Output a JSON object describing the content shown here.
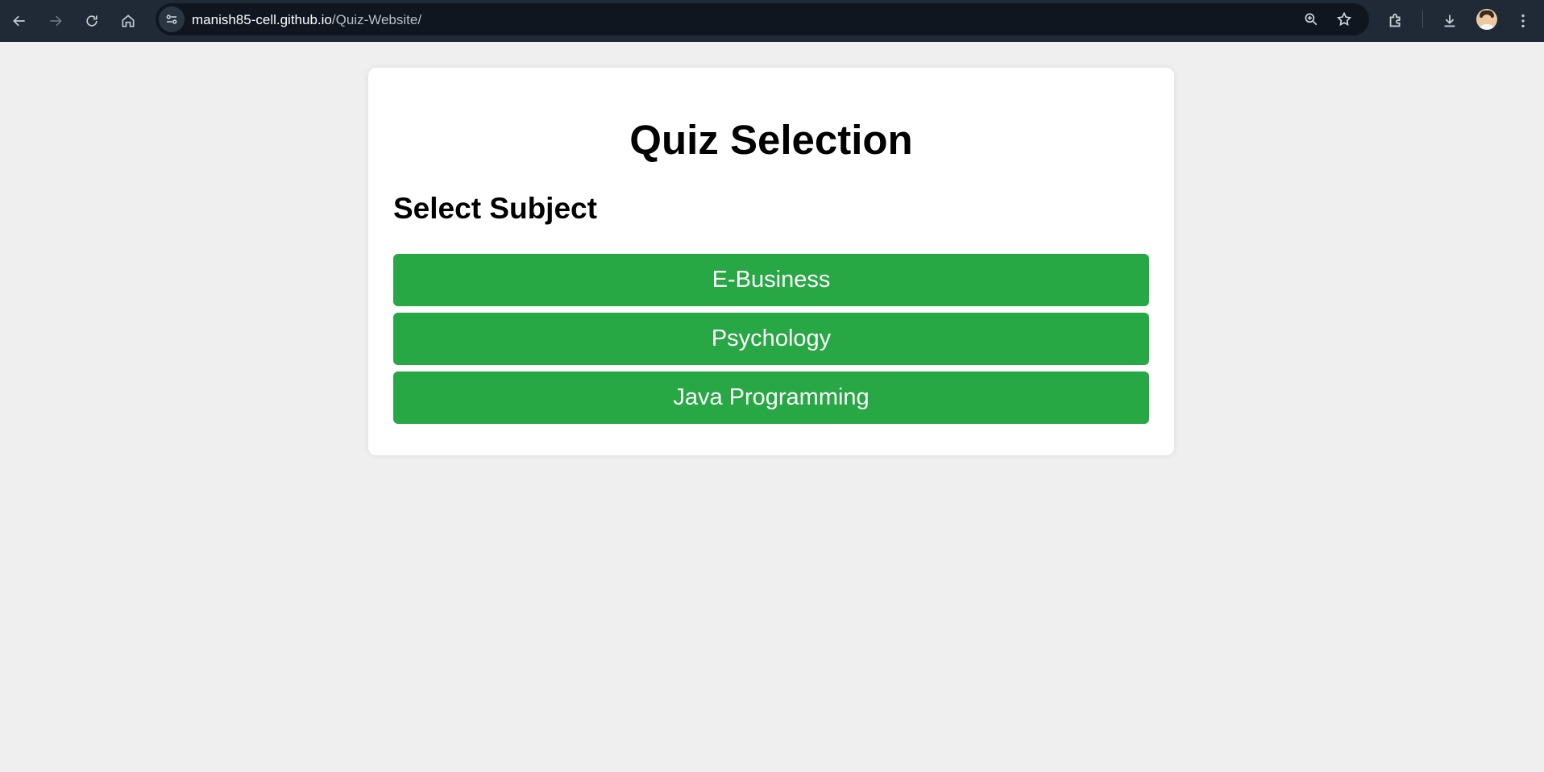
{
  "browser": {
    "url_host": "manish85-cell.github.io",
    "url_path": "/Quiz-Website/",
    "icons": [
      "back-icon",
      "forward-icon",
      "reload-icon",
      "home-icon",
      "site-info-icon",
      "zoom-icon",
      "bookmark-star-icon",
      "extensions-icon",
      "download-icon",
      "profile-avatar",
      "menu-icon"
    ]
  },
  "page": {
    "title": "Quiz Selection",
    "section_title": "Select Subject",
    "subjects": [
      {
        "label": "E-Business"
      },
      {
        "label": "Psychology"
      },
      {
        "label": "Java Programming"
      }
    ],
    "colors": {
      "button": "#28a745",
      "background": "#efefef",
      "toolbar": "#1f2a36"
    }
  }
}
